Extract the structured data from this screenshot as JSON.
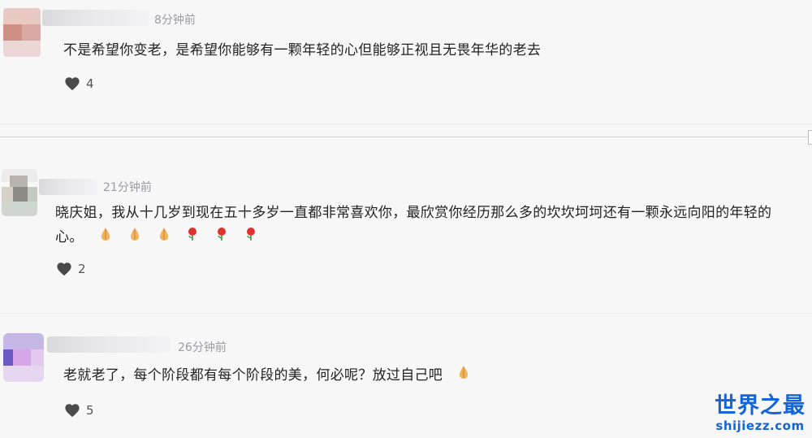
{
  "comments": [
    {
      "time": "8分钟前",
      "text": "不是希望你变老，是希望你能够有一颗年轻的心但能够正视且无畏年华的老去",
      "likes": "4"
    },
    {
      "time": "21分钟前",
      "text_line1": "晓庆姐，我从十几岁到现在五十多岁一直都非常喜欢你，最欣赏你经历那么多的坎坎坷坷还有一颗永远向阳的年轻的",
      "text_line2": "心。",
      "emojis": [
        "clasped-hands-emoji",
        "clasped-hands-emoji",
        "clasped-hands-emoji",
        "rose-emoji",
        "rose-emoji",
        "rose-emoji"
      ],
      "likes": "2"
    },
    {
      "time": "26分钟前",
      "text": "老就老了，每个阶段都有每个阶段的美，何必呢？放过自己吧",
      "emojis": [
        "clasped-hands-emoji"
      ],
      "likes": "5"
    }
  ],
  "watermark": {
    "main": "世界之最",
    "sub": "shijiezz.com"
  },
  "colors": {
    "background": "#f7f7f8",
    "heart": "#4a4a4a",
    "watermark": "#1565d8"
  }
}
